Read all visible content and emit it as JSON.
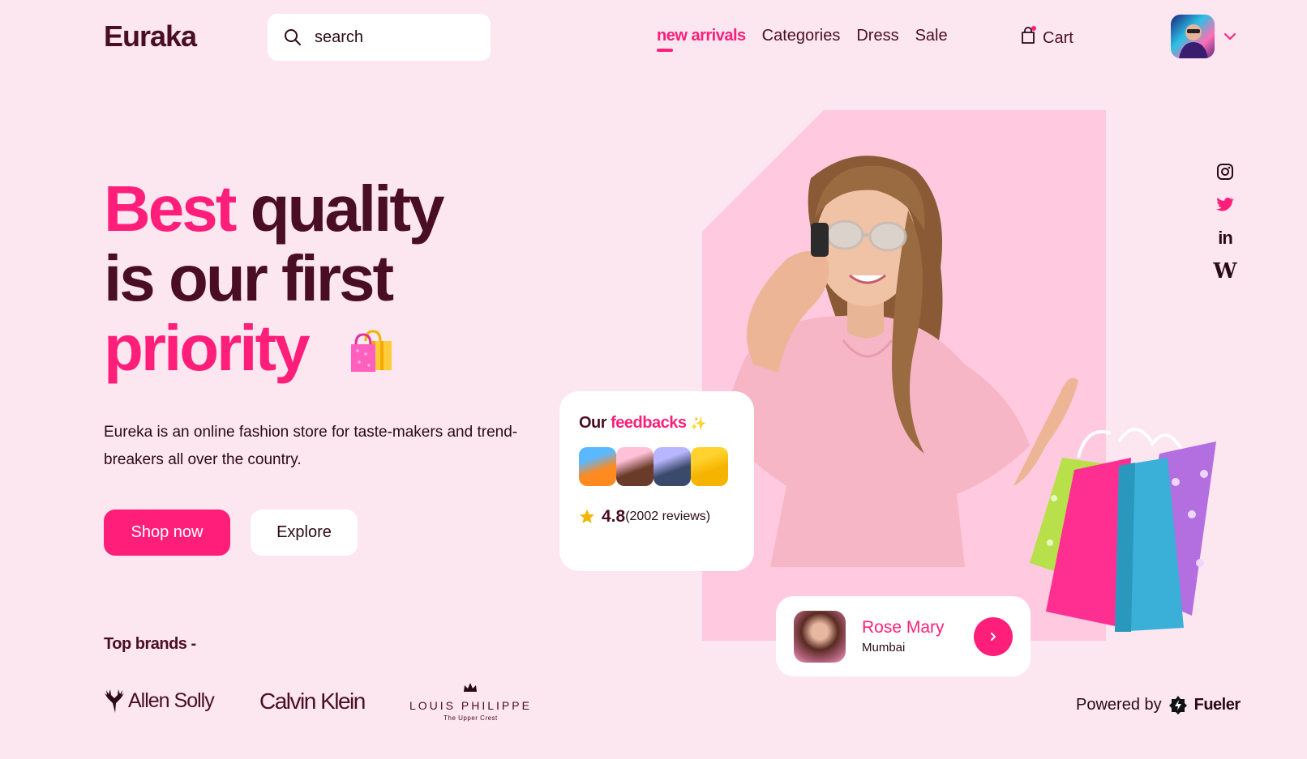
{
  "header": {
    "logo": "Euraka",
    "search_placeholder": "search",
    "nav": [
      "new arrivals",
      "Categories",
      "Dress",
      "Sale"
    ],
    "cart_label": "Cart"
  },
  "hero": {
    "line1_pink": "Best",
    "line1_dark": " quality",
    "line2": "is our first",
    "line3": "priority",
    "description": "Eureka is an online fashion store for taste-makers and trend-breakers all over the country.",
    "shop_button": "Shop now",
    "explore_button": "Explore"
  },
  "brands": {
    "title": "Top brands -",
    "allen_solly": "Allen Solly",
    "calvin_klein": "Calvin Klein",
    "louis_philippe": "LOUIS PHILIPPE",
    "louis_tagline": "The Upper Crest"
  },
  "feedback": {
    "title_dark": "Our ",
    "title_pink": "feedbacks",
    "sparkle": "✨",
    "rating": "4.8",
    "reviews": "(2002 reviews)"
  },
  "profile": {
    "name": "Rose Mary",
    "city": "Mumbai"
  },
  "footer": {
    "powered_by": "Powered by",
    "brand": "Fueler"
  },
  "social_icons": [
    "instagram-icon",
    "twitter-icon",
    "linkedin-icon",
    "wikipedia-icon"
  ],
  "colors": {
    "accent": "#ff1f7a",
    "dark": "#4a0e24",
    "background": "#fce6ef",
    "photo_panel": "#ffc9df"
  }
}
